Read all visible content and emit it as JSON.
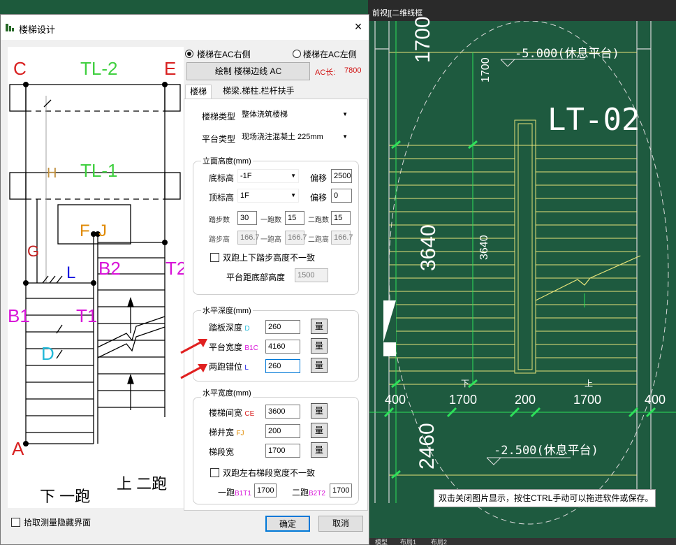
{
  "dialog": {
    "title": "楼梯设计",
    "close_icon": "×"
  },
  "preview": {
    "labels": {
      "C": "C",
      "E": "E",
      "TL2": "TL-2",
      "TL1": "TL-1",
      "H": "H",
      "G": "G",
      "F": "F",
      "J": "J",
      "L": "L",
      "B2": "B2",
      "T2": "T2",
      "B1": "B1",
      "T1": "T1",
      "D": "D",
      "A": "A"
    },
    "bottom_left": "下 一跑",
    "bottom_right": "上 二跑"
  },
  "top": {
    "radio_right": "楼梯在AC右侧",
    "radio_left": "楼梯在AC左侧",
    "draw_button": "绘制 楼梯边线 AC",
    "ac_label": "AC长:",
    "ac_value": "7800"
  },
  "tabs": [
    "楼梯",
    "梯梁.梯柱.栏杆扶手"
  ],
  "stair": {
    "type_label": "楼梯类型",
    "type_value": "整体浇筑楼梯",
    "platform_label": "平台类型",
    "platform_value": "现场浇注混凝土 225mm"
  },
  "elevation": {
    "title": "立面高度(mm)",
    "bottom_label": "底标高",
    "bottom_value": "-1F",
    "bottom_offset_label": "偏移",
    "bottom_offset_value": "2500",
    "top_label": "顶标高",
    "top_value": "1F",
    "top_offset_label": "偏移",
    "top_offset_value": "0",
    "steps_label": "踏步数",
    "steps_value": "30",
    "run1_label": "一跑数",
    "run1_value": "15",
    "run2_label": "二跑数",
    "run2_value": "15",
    "step_h_label": "踏步高",
    "step_h_value": "166.7",
    "run1_h_label": "一跑高",
    "run1_h_value": "166.7",
    "run2_h_label": "二跑高",
    "run2_h_value": "166.7",
    "checkbox": "双跑上下踏步高度不一致",
    "platform_bottom_label": "平台距底部高度",
    "platform_bottom_value": "1500"
  },
  "depth": {
    "title": "水平深度(mm)",
    "tread_label": "踏板深度",
    "tread_key": "D",
    "tread_value": "260",
    "plat_label": "平台宽度",
    "plat_key": "B1C",
    "plat_value": "4160",
    "offset_label": "两跑错位",
    "offset_key": "L",
    "offset_value": "260",
    "measure": "量"
  },
  "width": {
    "title": "水平宽度(mm)",
    "stair_label": "楼梯间宽",
    "stair_key": "CE",
    "stair_value": "3600",
    "well_label": "梯井宽",
    "well_key": "FJ",
    "well_value": "200",
    "seg_label": "梯段宽",
    "seg_value": "1700",
    "measure": "量",
    "checkbox": "双跑左右梯段宽度不一致",
    "run1_label": "一跑",
    "run1_key": "B1T1",
    "run1_value": "1700",
    "run2_label": "二跑",
    "run2_key": "B2T2",
    "run2_value": "1700"
  },
  "footer": {
    "checkbox": "拾取测量隐藏界面",
    "ok": "确定",
    "cancel": "取消"
  },
  "cad": {
    "view_label": "前视][二维线框",
    "title": "LT-02",
    "top_platform": "-5.000(休息平台)",
    "bottom_platform": "-2.500(休息平台)",
    "dims": {
      "d1700v": "1700",
      "d1700v_small": "1700",
      "d3640": "3640",
      "d3640_small": "3640",
      "d2460": "2460",
      "w400a": "400",
      "w1700a": "1700",
      "w200": "200",
      "w1700b": "1700",
      "w400b": "400",
      "down": "下",
      "up": "上"
    },
    "tooltip": "双击关闭图片显示，按住CTRL手动可以拖进软件或保存。",
    "tabs": [
      "模型",
      "布局1",
      "布局2"
    ]
  }
}
